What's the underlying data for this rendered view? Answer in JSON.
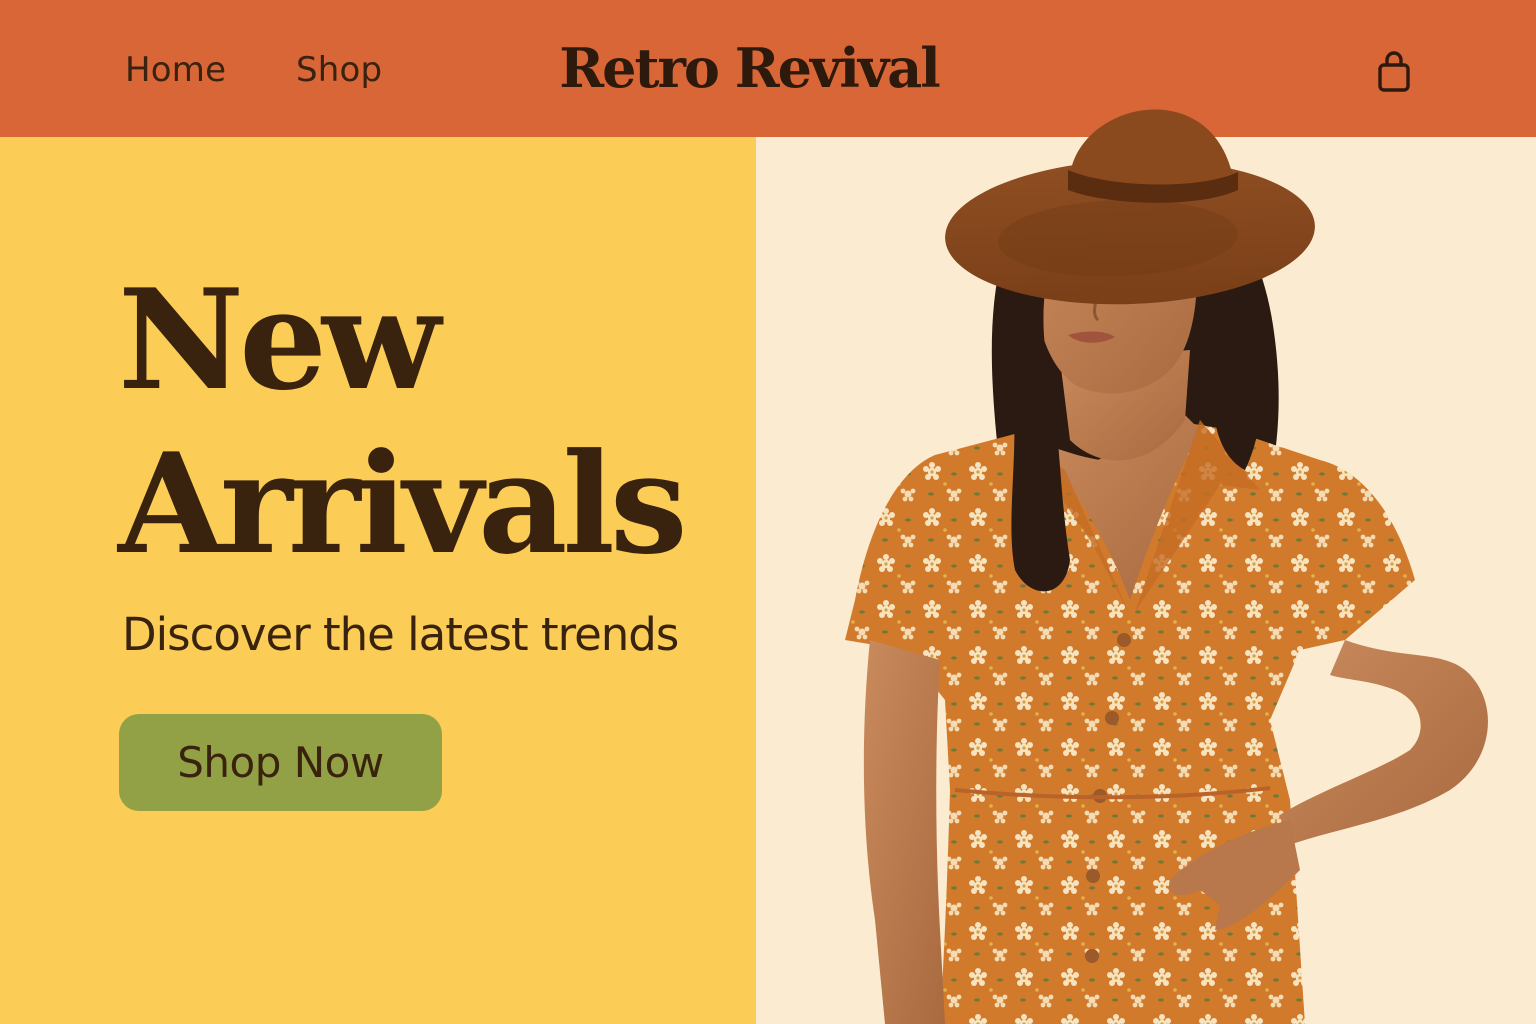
{
  "header": {
    "nav": [
      {
        "label": "Home"
      },
      {
        "label": "Shop"
      }
    ],
    "brand": "Retro Revival",
    "cart_icon": "shopping-bag-icon"
  },
  "hero": {
    "headline_line1": "New",
    "headline_line2": "Arrivals",
    "subtitle": "Discover the latest trends",
    "cta_label": "Shop Now",
    "image_alt": "Model in brown felt hat and orange floral dress"
  },
  "colors": {
    "header_bg": "#d96637",
    "hero_left_bg": "#fbcd57",
    "hero_right_bg": "#fbecd1",
    "cta_bg": "#92a145",
    "text_dark": "#3a230e"
  }
}
